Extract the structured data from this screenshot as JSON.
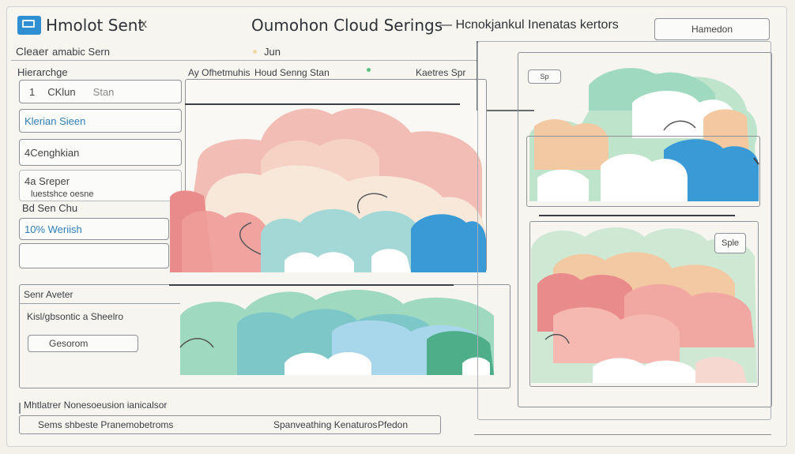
{
  "window": {
    "title": "Hmolot Sent",
    "title_suffix": "x",
    "center_title": "Oumohon Cloud Serings",
    "center_title_suffix": "— Hcnokjankul Inenatas kertors",
    "header_button": "Hamedon"
  },
  "toolbar": {
    "clear_label": "Cleaer",
    "section_label": "amabic Sern",
    "sub_label": "Jun",
    "hierarchy_label": "Hierarchge"
  },
  "preview_bar": {
    "left_text": "Ay Ofhetmuhis",
    "mid_text": "Houd Senng Stan",
    "right_text": "Kaetres Spr"
  },
  "sidebar": {
    "items": [
      {
        "num": "1",
        "label": "CKlun",
        "extra": "Stan"
      },
      {
        "label": "Klerian Sieen"
      },
      {
        "label": "4Cenghkian"
      },
      {
        "label": "4a Sreper",
        "sub": "luestshce oesne"
      }
    ],
    "bsd_label": "Bd Sen Chu",
    "search_value": "10% Weriish"
  },
  "lower_panel": {
    "title": "Senr Aveter",
    "subtitle": "Kisl/gbsontic a Sheelro",
    "input_value": "Gesorom"
  },
  "right_panel": {
    "mini_label": "Sp",
    "button_label": "Sple"
  },
  "footer": {
    "status": "Mhtlatrer Nonesoeusion ianicalsor",
    "left_text": "Sems shbeste Pranemobetroms",
    "mid_text": "Spanveathing Kenaturos",
    "right_text": "Pfedon"
  },
  "colors": {
    "accent_blue": "#2f8fd0",
    "cloud_pink": "#e98b8b",
    "cloud_peach": "#f2c9a2",
    "cloud_mint": "#9fd9c0",
    "cloud_sky": "#9fd4e8",
    "cloud_deep_blue": "#3a9ad6"
  }
}
